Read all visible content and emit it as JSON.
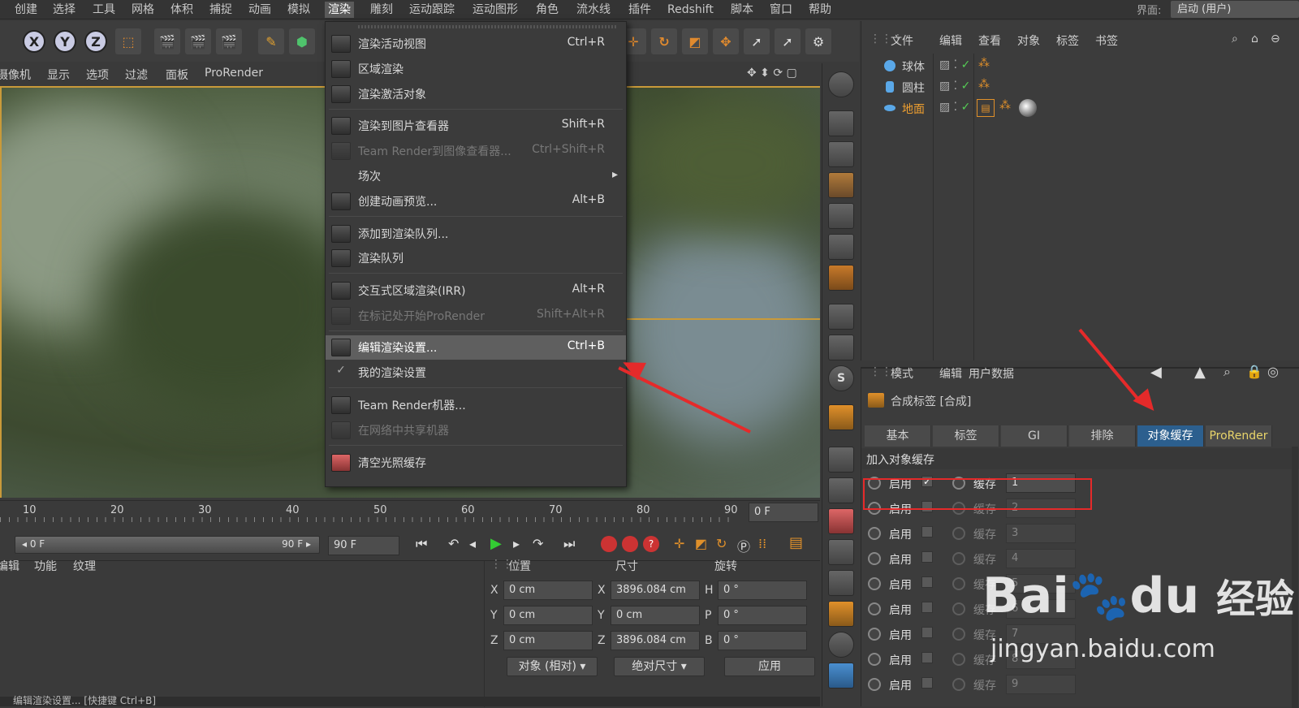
{
  "menubar": {
    "items": [
      "创建",
      "选择",
      "工具",
      "网格",
      "体积",
      "捕捉",
      "动画",
      "模拟",
      "渲染",
      "雕刻",
      "运动跟踪",
      "运动图形",
      "角色",
      "流水线",
      "插件",
      "Redshift",
      "脚本",
      "窗口",
      "帮助"
    ],
    "interface_label": "界面:",
    "interface_value": "启动 (用户)"
  },
  "viewport_menu": [
    "摄像机",
    "显示",
    "选项",
    "过滤",
    "面板",
    "ProRender"
  ],
  "render_menu": {
    "items": [
      {
        "label": "渲染活动视图",
        "shortcut": "Ctrl+R",
        "disabled": false
      },
      {
        "label": "区域渲染",
        "shortcut": "",
        "disabled": false
      },
      {
        "label": "渲染激活对象",
        "shortcut": "",
        "disabled": false
      },
      {
        "label": "渲染到图片查看器",
        "shortcut": "Shift+R",
        "disabled": false
      },
      {
        "label": "Team Render到图像查看器...",
        "shortcut": "Ctrl+Shift+R",
        "disabled": true
      },
      {
        "label": "场次",
        "shortcut": "",
        "disabled": false
      },
      {
        "label": "创建动画预览...",
        "shortcut": "Alt+B",
        "disabled": false
      },
      {
        "label": "添加到渲染队列...",
        "shortcut": "",
        "disabled": false
      },
      {
        "label": "渲染队列",
        "shortcut": "",
        "disabled": false
      },
      {
        "label": "交互式区域渲染(IRR)",
        "shortcut": "Alt+R",
        "disabled": false
      },
      {
        "label": "在标记处开始ProRender",
        "shortcut": "Shift+Alt+R",
        "disabled": true
      },
      {
        "label": "编辑渲染设置...",
        "shortcut": "Ctrl+B",
        "disabled": false
      },
      {
        "label": "我的渲染设置",
        "shortcut": "",
        "disabled": false
      },
      {
        "label": "Team Render机器...",
        "shortcut": "",
        "disabled": false
      },
      {
        "label": "在网络中共享机器",
        "shortcut": "",
        "disabled": true
      },
      {
        "label": "清空光照缓存",
        "shortcut": "",
        "disabled": false
      }
    ]
  },
  "object_manager": {
    "menu": [
      "文件",
      "编辑",
      "查看",
      "对象",
      "标签",
      "书签"
    ],
    "objects": [
      "球体",
      "圆柱",
      "地面"
    ]
  },
  "attribute_manager": {
    "menu": [
      "模式",
      "编辑",
      "用户数据"
    ],
    "title": "合成标签 [合成]",
    "tabs": [
      "基本",
      "标签",
      "GI",
      "排除",
      "对象缓存",
      "ProRender"
    ],
    "section": "加入对象缓存",
    "enable_label": "启用",
    "buffer_label": "缓存",
    "rows": [
      "1",
      "2",
      "3",
      "4",
      "5",
      "6",
      "7",
      "8",
      "9"
    ]
  },
  "timeline": {
    "ticks": [
      "10",
      "20",
      "30",
      "40",
      "50",
      "60",
      "70",
      "80",
      "90"
    ],
    "frame_field": "0 F",
    "range_start": "0 F",
    "range_end": "90 F",
    "end_field": "90 F"
  },
  "bottom": {
    "tabs": [
      "编辑",
      "功能",
      "纹理"
    ],
    "headers": [
      "位置",
      "尺寸",
      "旋转"
    ],
    "pos": [
      "0 cm",
      "0 cm",
      "0 cm"
    ],
    "size": [
      "3896.084 cm",
      "0 cm",
      "3896.084 cm"
    ],
    "rot": [
      "0 °",
      "0 °",
      "0 °"
    ],
    "axis_pos": [
      "X",
      "Y",
      "Z"
    ],
    "axis_rot": [
      "H",
      "P",
      "B"
    ],
    "dd_object": "对象 (相对)",
    "dd_size": "绝对尺寸",
    "apply": "应用"
  },
  "statusbar": "编辑渲染设置... [快捷键 Ctrl+B]",
  "watermark": {
    "brand": "Bai",
    "du": "du",
    "cn": "经验",
    "url": "jingyan.baidu.com"
  },
  "colors": {
    "accent": "#2c5f8e",
    "annotation": "#e52a2a",
    "highlight": "#5f5f5f"
  }
}
